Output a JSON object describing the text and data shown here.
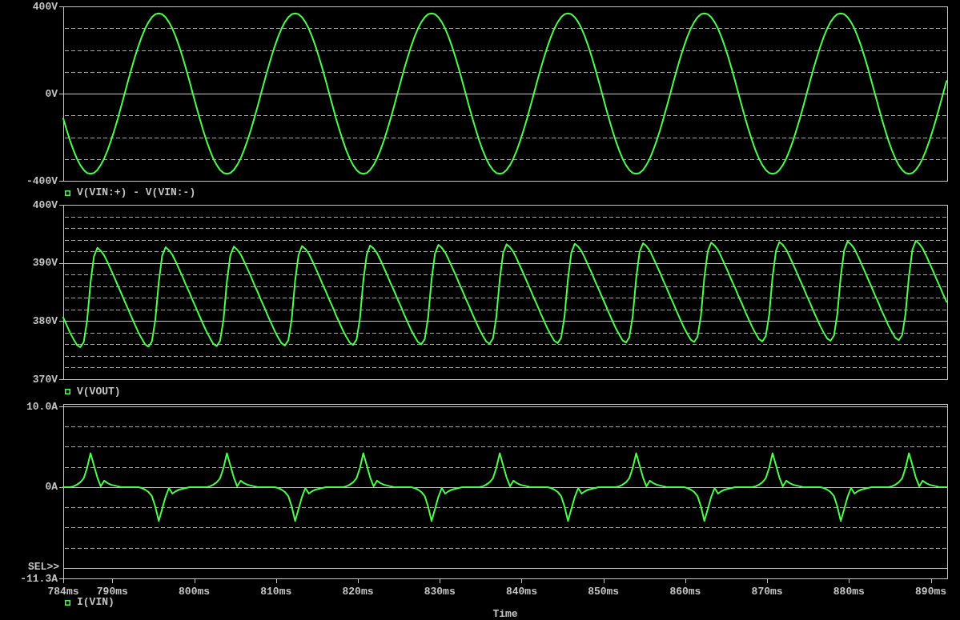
{
  "selection_marker": "SEL>>",
  "plots": [
    {
      "selected": false,
      "chart_data": {
        "type": "line",
        "xlim": [
          784,
          892
        ],
        "ylim": [
          -400,
          400
        ],
        "yticks": [
          {
            "value": 400,
            "label": "400V"
          },
          {
            "value": 0,
            "label": "0V"
          },
          {
            "value": -400,
            "label": "-400V"
          }
        ],
        "x": [
          784,
          784.417,
          784.833,
          785.25,
          785.667,
          786.083,
          786.5,
          786.917,
          787.333,
          787.75,
          788.167,
          788.583,
          789,
          789.417,
          789.833,
          790.25,
          790.667,
          791.083,
          791.5,
          791.917,
          792.333,
          792.75,
          793.167,
          793.583,
          794,
          794.417,
          794.833,
          795.25,
          795.667,
          796.083,
          796.5,
          796.917,
          797.333,
          797.75,
          798.167,
          798.583,
          799,
          799.417,
          799.833,
          800.25,
          800.667,
          801.083,
          801.5,
          801.917,
          802.333,
          802.75,
          803.167,
          803.583,
          804,
          804.417,
          804.833,
          805.25,
          805.667,
          806.083,
          806.5,
          806.917,
          807.333,
          807.75,
          808.167,
          808.583,
          809,
          809.417,
          809.833,
          810.25,
          810.667,
          811.083,
          811.5,
          811.917,
          812.333,
          812.75,
          813.167,
          813.583,
          814,
          814.417,
          814.833,
          815.25,
          815.667,
          816.083,
          816.5,
          816.917,
          817.333,
          817.75,
          818.167,
          818.583,
          819,
          819.417,
          819.833,
          820.25,
          820.667,
          821.083,
          821.5,
          821.917,
          822.333,
          822.75,
          823.167,
          823.583,
          824,
          824.417,
          824.833,
          825.25,
          825.667,
          826.083,
          826.5,
          826.917,
          827.333,
          827.75,
          828.167,
          828.583,
          829,
          829.417,
          829.833,
          830.25,
          830.667,
          831.083,
          831.5,
          831.917,
          832.333,
          832.75,
          833.167,
          833.583,
          834,
          834.417,
          834.833,
          835.25,
          835.667,
          836.083,
          836.5,
          836.917,
          837.333,
          837.75,
          838.167,
          838.583,
          839,
          839.417,
          839.833,
          840.25,
          840.667,
          841.083,
          841.5,
          841.917,
          842.333,
          842.75,
          843.167,
          843.583,
          844,
          844.417,
          844.833,
          845.25,
          845.667,
          846.083,
          846.5,
          846.917,
          847.333,
          847.75,
          848.167,
          848.583,
          849,
          849.417,
          849.833,
          850.25,
          850.667,
          851.083,
          851.5,
          851.917,
          852.333,
          852.75,
          853.167,
          853.583,
          854,
          854.417,
          854.833,
          855.25,
          855.667,
          856.083,
          856.5,
          856.917,
          857.333,
          857.75,
          858.167,
          858.583,
          859,
          859.417,
          859.833,
          860.25,
          860.667,
          861.083,
          861.5,
          861.917,
          862.333,
          862.75,
          863.167,
          863.583,
          864,
          864.417,
          864.833,
          865.25,
          865.667,
          866.083,
          866.5,
          866.917,
          867.333,
          867.75,
          868.167,
          868.583,
          869,
          869.417,
          869.833,
          870.25,
          870.667,
          871.083,
          871.5,
          871.917,
          872.333,
          872.75,
          873.167,
          873.583,
          874,
          874.417,
          874.833,
          875.25,
          875.667,
          876.083,
          876.5,
          876.917,
          877.333,
          877.75,
          878.167,
          878.583,
          879,
          879.417,
          879.833,
          880.25,
          880.667,
          881.083,
          881.5,
          881.917,
          882.333,
          882.75,
          883.167,
          883.583,
          884,
          884.417,
          884.833,
          885.25,
          885.667,
          886.083,
          886.5,
          886.917,
          887.333,
          887.75,
          888.167,
          888.583,
          889,
          889.417,
          889.833,
          890.25,
          890.667,
          891.083,
          891.5,
          891.917
        ],
        "series": [
          {
            "name": "V(VIN:+) - V(VIN:-)",
            "color": "#4dff4d",
            "values": [
              -114,
              -167,
              -216,
              -260,
              -298,
              -328,
              -350,
              -364,
              -368,
              -364,
              -350,
              -328,
              -298,
              -260,
              -216,
              -167,
              -114,
              -58,
              0,
              58,
              114,
              167,
              216,
              260,
              298,
              328,
              350,
              364,
              368,
              364,
              350,
              328,
              298,
              260,
              216,
              167,
              114,
              58,
              0,
              -58,
              -114,
              -167,
              -216,
              -260,
              -298,
              -328,
              -350,
              -364,
              -368,
              -364,
              -350,
              -328,
              -298,
              -260,
              -216,
              -167,
              -114,
              -58,
              0,
              58,
              114,
              167,
              216,
              260,
              298,
              328,
              350,
              364,
              368,
              364,
              350,
              328,
              298,
              260,
              216,
              167,
              114,
              58,
              0,
              -58,
              -114,
              -167,
              -216,
              -260,
              -298,
              -328,
              -350,
              -364,
              -368,
              -364,
              -350,
              -328,
              -298,
              -260,
              -216,
              -167,
              -114,
              -58,
              0,
              58,
              114,
              167,
              216,
              260,
              298,
              328,
              350,
              364,
              368,
              364,
              350,
              328,
              298,
              260,
              216,
              167,
              114,
              58,
              0,
              -58,
              -114,
              -167,
              -216,
              -260,
              -298,
              -328,
              -350,
              -364,
              -368,
              -364,
              -350,
              -328,
              -298,
              -260,
              -216,
              -167,
              -114,
              -58,
              0,
              58,
              114,
              167,
              216,
              260,
              298,
              328,
              350,
              364,
              368,
              364,
              350,
              328,
              298,
              260,
              216,
              167,
              114,
              58,
              0,
              -58,
              -114,
              -167,
              -216,
              -260,
              -298,
              -328,
              -350,
              -364,
              -368,
              -364,
              -350,
              -328,
              -298,
              -260,
              -216,
              -167,
              -114,
              -58,
              0,
              58,
              114,
              167,
              216,
              260,
              298,
              328,
              350,
              364,
              368,
              364,
              350,
              328,
              298,
              260,
              216,
              167,
              114,
              58,
              0,
              -58,
              -114,
              -167,
              -216,
              -260,
              -298,
              -328,
              -350,
              -364,
              -368,
              -364,
              -350,
              -328,
              -298,
              -260,
              -216,
              -167,
              -114,
              -58,
              0,
              58,
              114,
              167,
              216,
              260,
              298,
              328,
              350,
              364,
              368,
              364,
              350,
              328,
              298,
              260,
              216,
              167,
              114,
              58,
              0,
              -58,
              -114,
              -167,
              -216,
              -260,
              -298,
              -328,
              -350,
              -364,
              -368,
              -364,
              -350,
              -328,
              -298,
              -260,
              -216,
              -167,
              -114,
              -58,
              0,
              58
            ]
          }
        ]
      }
    },
    {
      "selected": false,
      "chart_data": {
        "type": "line",
        "xlim": [
          784,
          892
        ],
        "ylim": [
          370,
          400
        ],
        "yticks": [
          {
            "value": 400,
            "label": "400V"
          },
          {
            "value": 390,
            "label": "390V"
          },
          {
            "value": 380,
            "label": "380V"
          },
          {
            "value": 370,
            "label": "370V"
          }
        ],
        "x": [
          784,
          784.417,
          784.833,
          785.25,
          785.667,
          786.083,
          786.5,
          786.917,
          787.333,
          787.75,
          788.167,
          788.583,
          789,
          789.417,
          789.833,
          790.25,
          790.667,
          791.083,
          791.5,
          791.917,
          792.333,
          792.75,
          793.167,
          793.583,
          794,
          794.417,
          794.833,
          795.25,
          795.667,
          796.083,
          796.5,
          796.917,
          797.333,
          797.75,
          798.167,
          798.583,
          799,
          799.417,
          799.833,
          800.25,
          800.667,
          801.083,
          801.5,
          801.917,
          802.333,
          802.75,
          803.167,
          803.583,
          804,
          804.417,
          804.833,
          805.25,
          805.667,
          806.083,
          806.5,
          806.917,
          807.333,
          807.75,
          808.167,
          808.583,
          809,
          809.417,
          809.833,
          810.25,
          810.667,
          811.083,
          811.5,
          811.917,
          812.333,
          812.75,
          813.167,
          813.583,
          814,
          814.417,
          814.833,
          815.25,
          815.667,
          816.083,
          816.5,
          816.917,
          817.333,
          817.75,
          818.167,
          818.583,
          819,
          819.417,
          819.833,
          820.25,
          820.667,
          821.083,
          821.5,
          821.917,
          822.333,
          822.75,
          823.167,
          823.583,
          824,
          824.417,
          824.833,
          825.25,
          825.667,
          826.083,
          826.5,
          826.917,
          827.333,
          827.75,
          828.167,
          828.583,
          829,
          829.417,
          829.833,
          830.25,
          830.667,
          831.083,
          831.5,
          831.917,
          832.333,
          832.75,
          833.167,
          833.583,
          834,
          834.417,
          834.833,
          835.25,
          835.667,
          836.083,
          836.5,
          836.917,
          837.333,
          837.75,
          838.167,
          838.583,
          839,
          839.417,
          839.833,
          840.25,
          840.667,
          841.083,
          841.5,
          841.917,
          842.333,
          842.75,
          843.167,
          843.583,
          844,
          844.417,
          844.833,
          845.25,
          845.667,
          846.083,
          846.5,
          846.917,
          847.333,
          847.75,
          848.167,
          848.583,
          849,
          849.417,
          849.833,
          850.25,
          850.667,
          851.083,
          851.5,
          851.917,
          852.333,
          852.75,
          853.167,
          853.583,
          854,
          854.417,
          854.833,
          855.25,
          855.667,
          856.083,
          856.5,
          856.917,
          857.333,
          857.75,
          858.167,
          858.583,
          859,
          859.417,
          859.833,
          860.25,
          860.667,
          861.083,
          861.5,
          861.917,
          862.333,
          862.75,
          863.167,
          863.583,
          864,
          864.417,
          864.833,
          865.25,
          865.667,
          866.083,
          866.5,
          866.917,
          867.333,
          867.75,
          868.167,
          868.583,
          869,
          869.417,
          869.833,
          870.25,
          870.667,
          871.083,
          871.5,
          871.917,
          872.333,
          872.75,
          873.167,
          873.583,
          874,
          874.417,
          874.833,
          875.25,
          875.667,
          876.083,
          876.5,
          876.917,
          877.333,
          877.75,
          878.167,
          878.583,
          879,
          879.417,
          879.833,
          880.25,
          880.667,
          881.083,
          881.5,
          881.917,
          882.333,
          882.75,
          883.167,
          883.583,
          884,
          884.417,
          884.833,
          885.25,
          885.667,
          886.083,
          886.5,
          886.917,
          887.333,
          887.75,
          888.167,
          888.583,
          889,
          889.417,
          889.833,
          890.25,
          890.667,
          891.083,
          891.5,
          891.917
        ],
        "series": [
          {
            "name": "V(VOUT)",
            "color": "#4dff4d",
            "values": [
              380.6,
              379.3,
              378.0,
              376.9,
              375.9,
              375.5,
              376.4,
              380.1,
              386.6,
              391.1,
              392.6,
              392.1,
              391.3,
              390.1,
              388.8,
              387.5,
              386.1,
              384.8,
              383.4,
              382.1,
              380.7,
              379.4,
              378.1,
              377.0,
              376.0,
              375.6,
              376.5,
              380.2,
              386.7,
              391.2,
              392.7,
              392.2,
              391.4,
              390.2,
              388.9,
              387.6,
              386.2,
              384.9,
              383.5,
              382.2,
              380.8,
              379.5,
              378.2,
              377.1,
              376.1,
              375.7,
              376.6,
              380.3,
              386.8,
              391.3,
              392.8,
              392.3,
              391.5,
              390.3,
              389.0,
              387.7,
              386.3,
              385.0,
              383.6,
              382.3,
              380.9,
              379.6,
              378.3,
              377.2,
              376.2,
              375.8,
              376.7,
              380.4,
              386.9,
              391.4,
              392.9,
              392.4,
              391.6,
              390.4,
              389.1,
              387.8,
              386.4,
              385.1,
              383.7,
              382.4,
              381.0,
              379.7,
              378.4,
              377.3,
              376.3,
              375.9,
              376.8,
              380.5,
              387.0,
              391.5,
              393.0,
              392.5,
              391.7,
              390.5,
              389.2,
              387.9,
              386.5,
              385.2,
              383.8,
              382.5,
              381.1,
              379.8,
              378.5,
              377.4,
              376.4,
              376.0,
              376.9,
              380.6,
              387.1,
              391.6,
              393.1,
              392.6,
              391.8,
              390.6,
              389.3,
              388.0,
              386.6,
              385.3,
              383.9,
              382.6,
              381.2,
              379.9,
              378.6,
              377.5,
              376.5,
              376.1,
              377.0,
              380.7,
              387.2,
              391.7,
              393.2,
              392.7,
              391.9,
              390.7,
              389.4,
              388.1,
              386.7,
              385.4,
              384.0,
              382.7,
              381.3,
              380.0,
              378.7,
              377.6,
              376.6,
              376.2,
              377.1,
              380.8,
              387.3,
              391.8,
              393.3,
              392.8,
              392.0,
              390.8,
              389.5,
              388.2,
              386.8,
              385.5,
              384.1,
              382.8,
              381.4,
              380.1,
              378.8,
              377.7,
              376.7,
              376.3,
              377.2,
              380.9,
              387.4,
              391.9,
              393.4,
              392.9,
              392.1,
              390.9,
              389.6,
              388.3,
              386.9,
              385.6,
              384.2,
              382.9,
              381.5,
              380.2,
              378.9,
              377.8,
              376.8,
              376.4,
              377.3,
              381.0,
              387.5,
              392.0,
              393.5,
              393.0,
              392.2,
              391.0,
              389.7,
              388.4,
              387.0,
              385.7,
              384.3,
              383.0,
              381.6,
              380.3,
              379.0,
              377.9,
              376.9,
              376.5,
              377.4,
              381.1,
              387.6,
              392.1,
              393.6,
              393.1,
              392.3,
              391.1,
              389.8,
              388.5,
              387.1,
              385.8,
              384.4,
              383.1,
              381.7,
              380.4,
              379.1,
              378.0,
              377.0,
              376.6,
              377.5,
              381.2,
              387.7,
              392.2,
              393.7,
              393.2,
              392.4,
              391.2,
              389.9,
              388.6,
              387.2,
              385.9,
              384.5,
              383.2,
              381.8,
              380.5,
              379.2,
              378.1,
              377.1,
              376.7,
              377.6,
              381.3,
              387.8,
              392.3,
              393.8,
              393.3,
              392.5,
              391.3,
              390.0,
              388.7,
              387.3,
              386.0,
              384.6,
              383.3
            ]
          }
        ]
      }
    },
    {
      "selected": true,
      "chart_data": {
        "type": "line",
        "xlim": [
          784,
          892
        ],
        "ylim": [
          -11.3,
          10.3
        ],
        "xlabel": "Time",
        "xticks": [
          {
            "value": 784,
            "label": "784ms"
          },
          {
            "value": 790,
            "label": "790ms"
          },
          {
            "value": 800,
            "label": "800ms"
          },
          {
            "value": 810,
            "label": "810ms"
          },
          {
            "value": 820,
            "label": "820ms"
          },
          {
            "value": 830,
            "label": "830ms"
          },
          {
            "value": 840,
            "label": "840ms"
          },
          {
            "value": 850,
            "label": "850ms"
          },
          {
            "value": 860,
            "label": "860ms"
          },
          {
            "value": 870,
            "label": "870ms"
          },
          {
            "value": 880,
            "label": "880ms"
          },
          {
            "value": 890,
            "label": "890ms"
          }
        ],
        "yticks": [
          {
            "value": 10,
            "label": "10.0A"
          },
          {
            "value": 0,
            "label": "0A"
          },
          {
            "value": -11.3,
            "label": "-11.3A"
          }
        ],
        "x": [
          784,
          784.417,
          784.833,
          785.25,
          785.667,
          786.083,
          786.5,
          786.917,
          787.333,
          787.75,
          788.167,
          788.583,
          789,
          789.417,
          789.833,
          790.25,
          790.667,
          791.083,
          791.5,
          791.917,
          792.333,
          792.75,
          793.167,
          793.583,
          794,
          794.417,
          794.833,
          795.25,
          795.667,
          796.083,
          796.5,
          796.917,
          797.333,
          797.75,
          798.167,
          798.583,
          799,
          799.417,
          799.833,
          800.25,
          800.667,
          801.083,
          801.5,
          801.917,
          802.333,
          802.75,
          803.167,
          803.583,
          804,
          804.417,
          804.833,
          805.25,
          805.667,
          806.083,
          806.5,
          806.917,
          807.333,
          807.75,
          808.167,
          808.583,
          809,
          809.417,
          809.833,
          810.25,
          810.667,
          811.083,
          811.5,
          811.917,
          812.333,
          812.75,
          813.167,
          813.583,
          814,
          814.417,
          814.833,
          815.25,
          815.667,
          816.083,
          816.5,
          816.917,
          817.333,
          817.75,
          818.167,
          818.583,
          819,
          819.417,
          819.833,
          820.25,
          820.667,
          821.083,
          821.5,
          821.917,
          822.333,
          822.75,
          823.167,
          823.583,
          824,
          824.417,
          824.833,
          825.25,
          825.667,
          826.083,
          826.5,
          826.917,
          827.333,
          827.75,
          828.167,
          828.583,
          829,
          829.417,
          829.833,
          830.25,
          830.667,
          831.083,
          831.5,
          831.917,
          832.333,
          832.75,
          833.167,
          833.583,
          834,
          834.417,
          834.833,
          835.25,
          835.667,
          836.083,
          836.5,
          836.917,
          837.333,
          837.75,
          838.167,
          838.583,
          839,
          839.417,
          839.833,
          840.25,
          840.667,
          841.083,
          841.5,
          841.917,
          842.333,
          842.75,
          843.167,
          843.583,
          844,
          844.417,
          844.833,
          845.25,
          845.667,
          846.083,
          846.5,
          846.917,
          847.333,
          847.75,
          848.167,
          848.583,
          849,
          849.417,
          849.833,
          850.25,
          850.667,
          851.083,
          851.5,
          851.917,
          852.333,
          852.75,
          853.167,
          853.583,
          854,
          854.417,
          854.833,
          855.25,
          855.667,
          856.083,
          856.5,
          856.917,
          857.333,
          857.75,
          858.167,
          858.583,
          859,
          859.417,
          859.833,
          860.25,
          860.667,
          861.083,
          861.5,
          861.917,
          862.333,
          862.75,
          863.167,
          863.583,
          864,
          864.417,
          864.833,
          865.25,
          865.667,
          866.083,
          866.5,
          866.917,
          867.333,
          867.75,
          868.167,
          868.583,
          869,
          869.417,
          869.833,
          870.25,
          870.667,
          871.083,
          871.5,
          871.917,
          872.333,
          872.75,
          873.167,
          873.583,
          874,
          874.417,
          874.833,
          875.25,
          875.667,
          876.083,
          876.5,
          876.917,
          877.333,
          877.75,
          878.167,
          878.583,
          879,
          879.417,
          879.833,
          880.25,
          880.667,
          881.083,
          881.5,
          881.917,
          882.333,
          882.75,
          883.167,
          883.583,
          884,
          884.417,
          884.833,
          885.25,
          885.667,
          886.083,
          886.5,
          886.917,
          887.333,
          887.75,
          888.167,
          888.583,
          889,
          889.417,
          889.833,
          890.25,
          890.667,
          891.083,
          891.5,
          891.917
        ],
        "series": [
          {
            "name": "I(VIN)",
            "color": "#4dff4d",
            "values": [
              0,
              0,
              0,
              0.1,
              0.3,
              0.6,
              1.1,
              2.4,
              4.2,
              2.7,
              1.2,
              0.1,
              0.8,
              0.5,
              0.3,
              0.2,
              0.1,
              0,
              0,
              0,
              0,
              0,
              0,
              -0.1,
              -0.3,
              -0.6,
              -1.1,
              -2.4,
              -4.2,
              -2.7,
              -1.2,
              -0.1,
              -0.8,
              -0.5,
              -0.3,
              -0.2,
              -0.1,
              0,
              0,
              0,
              0,
              0,
              0,
              0.1,
              0.3,
              0.6,
              1.1,
              2.4,
              4.2,
              2.7,
              1.2,
              0.1,
              0.8,
              0.5,
              0.3,
              0.2,
              0.1,
              0,
              0,
              0,
              0,
              0,
              0,
              -0.1,
              -0.3,
              -0.6,
              -1.1,
              -2.4,
              -4.2,
              -2.7,
              -1.2,
              -0.1,
              -0.8,
              -0.5,
              -0.3,
              -0.2,
              -0.1,
              0,
              0,
              0,
              0,
              0,
              0,
              0.1,
              0.3,
              0.6,
              1.1,
              2.4,
              4.2,
              2.7,
              1.2,
              0.1,
              0.8,
              0.5,
              0.3,
              0.2,
              0.1,
              0,
              0,
              0,
              0,
              0,
              0,
              -0.1,
              -0.3,
              -0.6,
              -1.1,
              -2.4,
              -4.2,
              -2.7,
              -1.2,
              -0.1,
              -0.8,
              -0.5,
              -0.3,
              -0.2,
              -0.1,
              0,
              0,
              0,
              0,
              0,
              0,
              0.1,
              0.3,
              0.6,
              1.1,
              2.4,
              4.2,
              2.7,
              1.2,
              0.1,
              0.8,
              0.5,
              0.3,
              0.2,
              0.1,
              0,
              0,
              0,
              0,
              0,
              0,
              -0.1,
              -0.3,
              -0.6,
              -1.1,
              -2.4,
              -4.2,
              -2.7,
              -1.2,
              -0.1,
              -0.8,
              -0.5,
              -0.3,
              -0.2,
              -0.1,
              0,
              0,
              0,
              0,
              0,
              0,
              0.1,
              0.3,
              0.6,
              1.1,
              2.4,
              4.2,
              2.7,
              1.2,
              0.1,
              0.8,
              0.5,
              0.3,
              0.2,
              0.1,
              0,
              0,
              0,
              0,
              0,
              0,
              -0.1,
              -0.3,
              -0.6,
              -1.1,
              -2.4,
              -4.2,
              -2.7,
              -1.2,
              -0.1,
              -0.8,
              -0.5,
              -0.3,
              -0.2,
              -0.1,
              0,
              0,
              0,
              0,
              0,
              0,
              0.1,
              0.3,
              0.6,
              1.1,
              2.4,
              4.2,
              2.7,
              1.2,
              0.1,
              0.8,
              0.5,
              0.3,
              0.2,
              0.1,
              0,
              0,
              0,
              0,
              0,
              0,
              -0.1,
              -0.3,
              -0.6,
              -1.1,
              -2.4,
              -4.2,
              -2.7,
              -1.2,
              -0.1,
              -0.8,
              -0.5,
              -0.3,
              -0.2,
              -0.1,
              0,
              0,
              0,
              0,
              0,
              0,
              0.1,
              0.3,
              0.6,
              1.1,
              2.4,
              4.2,
              2.7,
              1.2,
              0.1,
              0.8,
              0.5,
              0.3,
              0.2,
              0.1,
              0,
              0,
              0
            ]
          }
        ]
      }
    }
  ]
}
